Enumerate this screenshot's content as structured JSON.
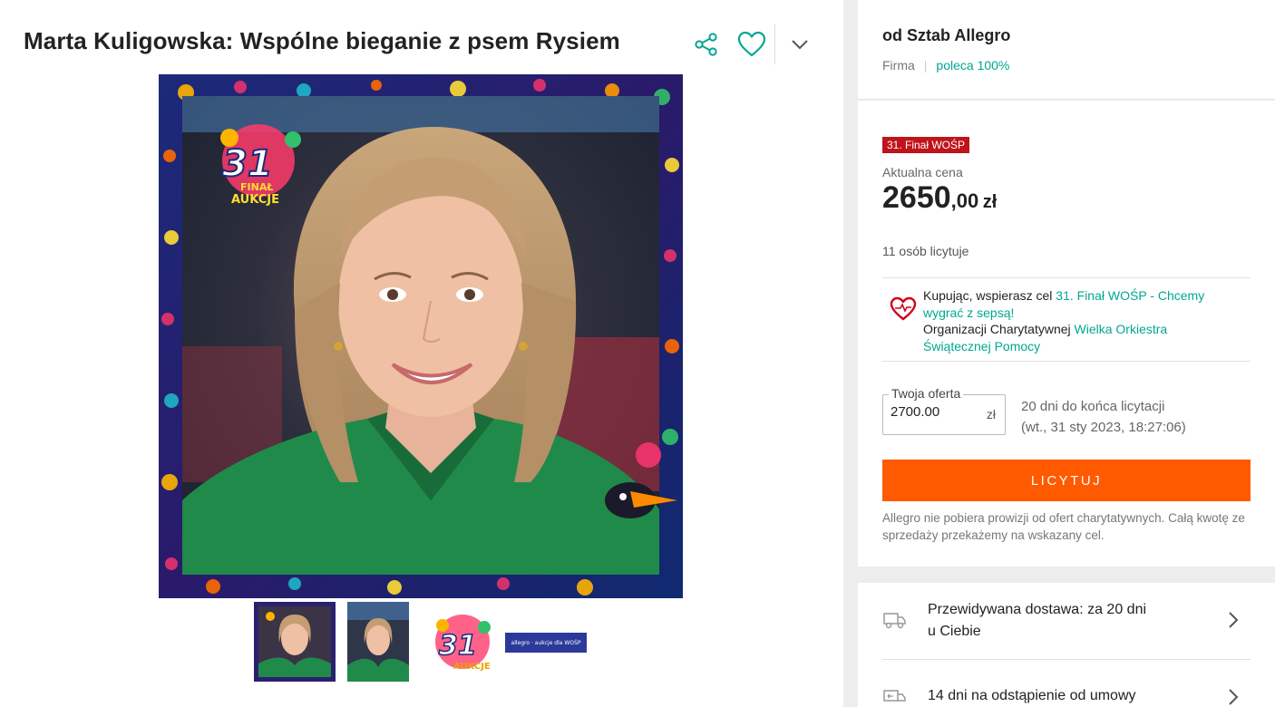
{
  "listing": {
    "title": "Marta Kuligowska: Wspólne bieganie z psem Rysiem",
    "thumb4_text": "allegro · aukcje dla WOŚP"
  },
  "logo": {
    "number": "31",
    "line1": "FINAŁ",
    "line2": "AUKCJE"
  },
  "seller": {
    "name": "od Sztab Allegro",
    "type": "Firma",
    "recommend": "poleca 100%"
  },
  "buy": {
    "badge": "31. Finał WOŚP",
    "price_label": "Aktualna cena",
    "price_int": "2650",
    "price_dec": ",00",
    "price_currency": "zł",
    "bidders": "11 osób licytuje",
    "charity_pre": "Kupując, wspierasz cel ",
    "charity_goal": "31. Finał WOŚP - Chcemy wygrać z sepsą!",
    "charity_org_pre": "Organizacji Charytatywnej ",
    "charity_org": "Wielka Orkiestra Świątecznej Pomocy",
    "offer_label": "Twoja oferta",
    "offer_value": "2700.00",
    "offer_currency": "zł",
    "ends_line1": "20 dni do końca licytacji",
    "ends_line2": "(wt., 31 sty 2023, 18:27:06)",
    "bid_button": "LICYTUJ",
    "disclaimer": "Allegro nie pobiera prowizji od ofert charytatywnych. Całą kwotę ze sprzedaży przekażemy na wskazany cel."
  },
  "info": {
    "delivery_line1": "Przewidywana dostawa: za 20 dni",
    "delivery_line2": "u Ciebie",
    "returns": "14 dni na odstąpienie od umowy"
  },
  "colors": {
    "accent": "#00a790",
    "bid_button": "#ff5a00",
    "badge": "#c0131b",
    "charity_heart": "#d0021b",
    "jacket_green": "#1f8a4a"
  },
  "icons": [
    "share-icon",
    "heart-icon",
    "chevron-down-icon",
    "charity-heart-icon",
    "truck-icon",
    "return-truck-icon",
    "chevron-right-icon"
  ]
}
